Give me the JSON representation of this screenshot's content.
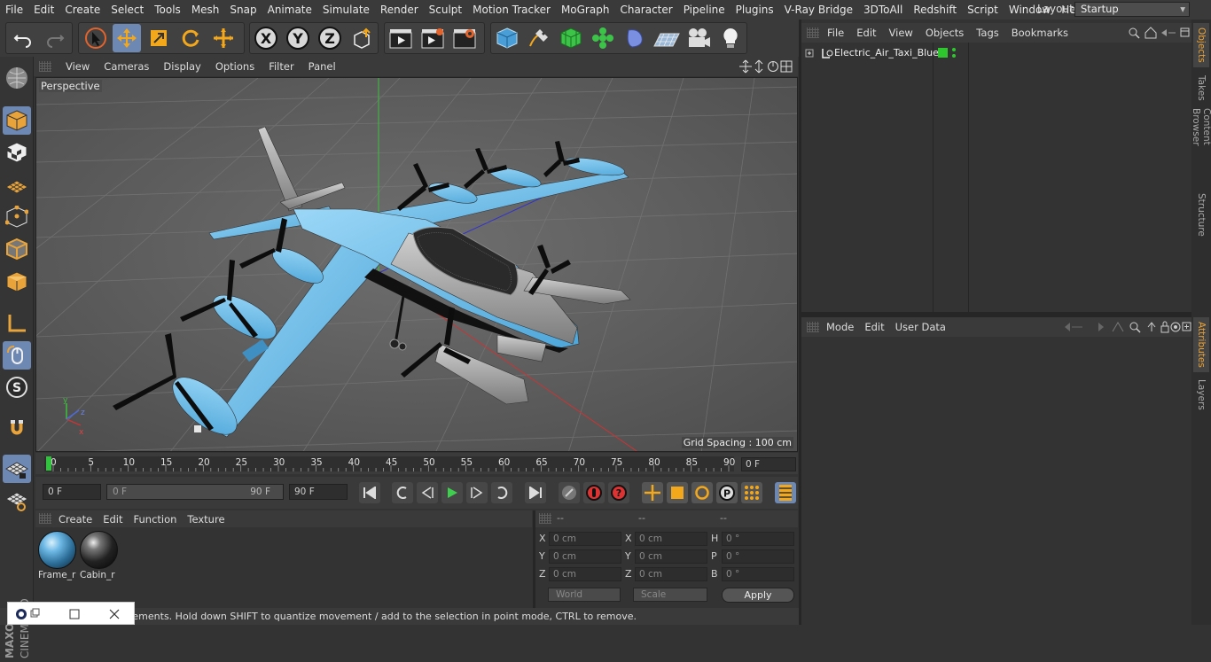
{
  "menubar": {
    "items": [
      "File",
      "Edit",
      "Create",
      "Select",
      "Tools",
      "Mesh",
      "Snap",
      "Animate",
      "Simulate",
      "Render",
      "Sculpt",
      "Motion Tracker",
      "MoGraph",
      "Character",
      "Pipeline",
      "Plugins",
      "V-Ray Bridge",
      "3DToAll",
      "Redshift",
      "Script",
      "Window",
      "Help"
    ],
    "layout_label": "Layout:",
    "layout_value": "Startup"
  },
  "toolbar": {
    "axis_x": "X",
    "axis_y": "Y",
    "axis_z": "Z",
    "icons": [
      "undo-icon",
      "redo-icon",
      "select-cursor-icon",
      "move-icon",
      "scale-icon",
      "rotate-icon",
      "recent-tool-icon",
      "axis-x-icon",
      "axis-y-icon",
      "axis-z-icon",
      "coordinate-system-icon",
      "render-view-icon",
      "render-picture-viewer-icon",
      "render-settings-icon",
      "cube-primitive-icon",
      "pen-spline-icon",
      "subdivision-surface-icon",
      "cloner-icon",
      "deformer-icon",
      "floor-icon",
      "camera-icon",
      "light-icon"
    ]
  },
  "viewport": {
    "menu": [
      "View",
      "Cameras",
      "Display",
      "Options",
      "Filter",
      "Panel"
    ],
    "label": "Perspective",
    "grid_spacing": "Grid Spacing : 100 cm",
    "accent": "#6fb6e6"
  },
  "timeline": {
    "ticks": [
      "0",
      "5",
      "10",
      "15",
      "20",
      "25",
      "30",
      "35",
      "40",
      "45",
      "50",
      "55",
      "60",
      "65",
      "70",
      "75",
      "80",
      "85",
      "90"
    ],
    "current_frame": "0 F"
  },
  "playbar": {
    "start": "0 F",
    "range_start": "0 F",
    "range_end": "90 F",
    "end": "90 F"
  },
  "materials": {
    "menu": [
      "Create",
      "Edit",
      "Function",
      "Texture"
    ],
    "items": [
      {
        "name": "Frame_r"
      },
      {
        "name": "Cabin_r"
      }
    ]
  },
  "coordinates": {
    "headers": [
      "--",
      "--",
      "--"
    ],
    "rows": [
      {
        "l1": "X",
        "v1": "0 cm",
        "l2": "X",
        "v2": "0 cm",
        "l3": "H",
        "v3": "0 °"
      },
      {
        "l1": "Y",
        "v1": "0 cm",
        "l2": "Y",
        "v2": "0 cm",
        "l3": "P",
        "v3": "0 °"
      },
      {
        "l1": "Z",
        "v1": "0 cm",
        "l2": "Z",
        "v2": "0 cm",
        "l3": "B",
        "v3": "0 °"
      }
    ],
    "space": "World",
    "mode": "Scale",
    "apply": "Apply"
  },
  "status": {
    "text": "Move: Click and drag to move elements. Hold down SHIFT to quantize movement / add to the selection in point mode, CTRL to remove."
  },
  "objects": {
    "menu": [
      "File",
      "Edit",
      "View",
      "Objects",
      "Tags",
      "Bookmarks"
    ],
    "items": [
      {
        "name": "Electric_Air_Taxi_Blue",
        "layer_color": "#2ec82e"
      }
    ]
  },
  "attributes": {
    "menu": [
      "Mode",
      "Edit",
      "User Data"
    ]
  },
  "right_tabs": [
    "Objects",
    "Takes",
    "Content Browser",
    "Structure",
    "Attributes",
    "Layers"
  ]
}
